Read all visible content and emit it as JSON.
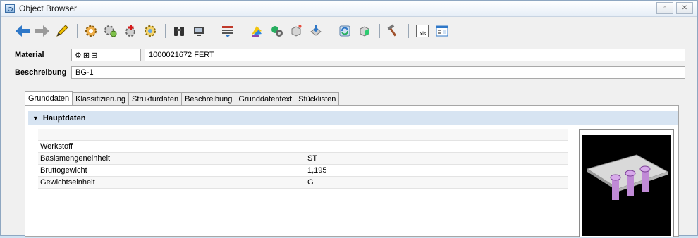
{
  "window": {
    "title": "Object Browser",
    "restore_icon": "restore-icon",
    "close_icon": "close-icon"
  },
  "toolbar": {
    "icons": [
      "back-arrow-icon",
      "forward-arrow-icon",
      "edit-pencil-icon",
      "gear-icon",
      "gears-icon",
      "gear-add-icon",
      "gear-settings-icon",
      "binoculars-icon",
      "monitor-icon",
      "list-icon",
      "paint-icon",
      "tools-icon",
      "cube-icon",
      "download-icon",
      "refresh-icon",
      "green-cube-icon",
      "hammer-icon",
      "xls-export-icon",
      "report-icon"
    ],
    "xls_label": ".xls"
  },
  "material": {
    "label": "Material",
    "icons": [
      "gear-small-icon",
      "structure-icon",
      "hierarchy-icon"
    ],
    "value": "1000021672  FERT"
  },
  "beschreibung": {
    "label": "Beschreibung",
    "value": "BG-1"
  },
  "tabs": [
    {
      "label": "Grunddaten",
      "active": true
    },
    {
      "label": "Klassifizierung",
      "active": false
    },
    {
      "label": "Strukturdaten",
      "active": false
    },
    {
      "label": "Beschreibung",
      "active": false
    },
    {
      "label": "Grunddatentext",
      "active": false
    },
    {
      "label": "Stücklisten",
      "active": false
    }
  ],
  "section": {
    "title": "Hauptdaten"
  },
  "table": {
    "rows": [
      {
        "name": "",
        "value": ""
      },
      {
        "name": "Werkstoff",
        "value": ""
      },
      {
        "name": "Basismengeneinheit",
        "value": "ST"
      },
      {
        "name": "Bruttogewicht",
        "value": "1,195"
      },
      {
        "name": "Gewichtseinheit",
        "value": "G"
      }
    ]
  },
  "colors": {
    "section_bg": "#d7e4f2",
    "title_gradient_top": "#ffffff",
    "title_gradient_bottom": "#e6eef7"
  }
}
